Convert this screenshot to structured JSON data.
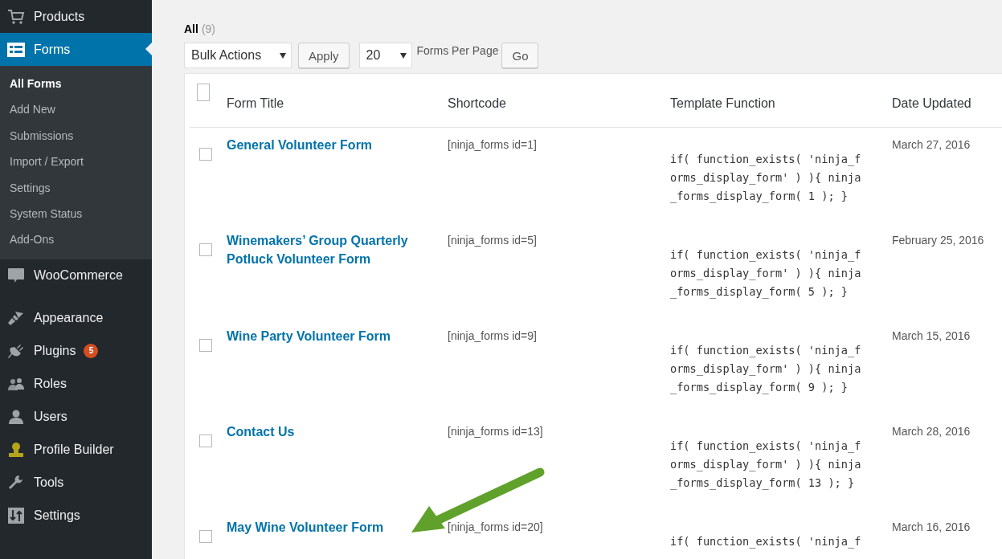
{
  "sidebar": {
    "groups": [
      [
        {
          "label": "Products",
          "selected": false
        },
        {
          "label": "Forms",
          "selected": true,
          "children": [
            {
              "label": "All Forms",
              "selected": true
            },
            {
              "label": "Add New",
              "selected": false
            },
            {
              "label": "Submissions",
              "selected": false
            },
            {
              "label": "Import / Export",
              "selected": false
            },
            {
              "label": "Settings",
              "selected": false
            },
            {
              "label": "System Status",
              "selected": false
            },
            {
              "label": "Add-Ons",
              "selected": false
            }
          ]
        },
        {
          "label": "WooCommerce",
          "selected": false
        }
      ],
      [
        {
          "label": "Appearance",
          "selected": false
        },
        {
          "label": "Plugins",
          "selected": false,
          "badge": "5"
        },
        {
          "label": "Roles",
          "selected": false
        },
        {
          "label": "Users",
          "selected": false
        },
        {
          "label": "Profile Builder",
          "selected": false
        },
        {
          "label": "Tools",
          "selected": false
        },
        {
          "label": "Settings",
          "selected": false
        }
      ]
    ]
  },
  "filter": {
    "label": "All",
    "count": "(9)"
  },
  "controls": {
    "bulk_actions": "Bulk Actions",
    "apply": "Apply",
    "per_page": "20",
    "per_page_label": "Forms Per Page",
    "go": "Go"
  },
  "table": {
    "header_checked": false,
    "columns": [
      "Form Title",
      "Shortcode",
      "Template Function",
      "Date Updated"
    ],
    "rows": [
      {
        "title": "General Volunteer Form",
        "shortcode": "[ninja_forms id=1]",
        "template": [
          "if( function_exists( 'ninja_f",
          "orms_display_form' ) ){ ninja",
          "_forms_display_form( 1 ); }"
        ],
        "date": "March 27, 2016",
        "checked": false
      },
      {
        "title": "Winemakers’ Group Quarterly Potluck Volunteer Form",
        "shortcode": "[ninja_forms id=5]",
        "template": [
          "if( function_exists( 'ninja_f",
          "orms_display_form' ) ){ ninja",
          "_forms_display_form( 5 ); }"
        ],
        "date": "February 25, 2016",
        "checked": false
      },
      {
        "title": "Wine Party Volunteer Form",
        "shortcode": "[ninja_forms id=9]",
        "template": [
          "if( function_exists( 'ninja_f",
          "orms_display_form' ) ){ ninja",
          "_forms_display_form( 9 ); }"
        ],
        "date": "March 15, 2016",
        "checked": false
      },
      {
        "title": "Contact Us",
        "shortcode": "[ninja_forms id=13]",
        "template": [
          "if( function_exists( 'ninja_f",
          "orms_display_form' ) ){ ninja",
          "_forms_display_form( 13 ); }"
        ],
        "date": "March 28, 2016",
        "checked": false
      },
      {
        "title": "May Wine Volunteer Form",
        "shortcode": "[ninja_forms id=20]",
        "template": [
          "if( function_exists( 'ninja_f"
        ],
        "date": "March 16, 2016",
        "checked": false
      }
    ]
  }
}
